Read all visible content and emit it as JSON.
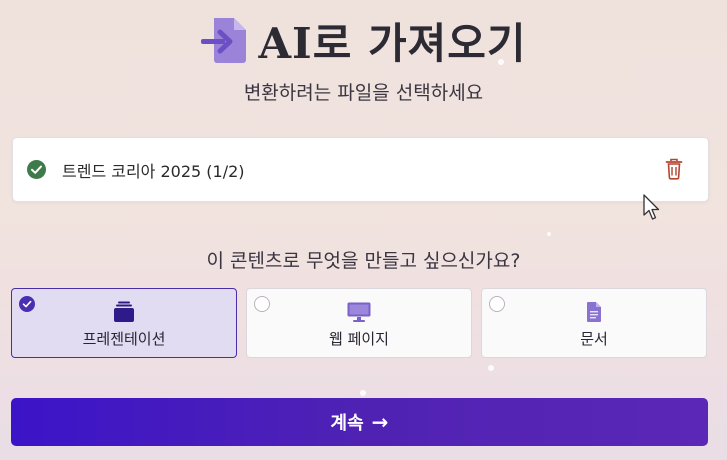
{
  "header": {
    "title": "AI로 가져오기",
    "subtitle": "변환하려는 파일을 선택하세요",
    "icon": "import-file-icon"
  },
  "file": {
    "name": "트렌드 코리아 2025 (1/2)",
    "status_icon": "check-circle-icon",
    "delete_icon": "trash-icon"
  },
  "question": "이 콘텐츠로 무엇을 만들고 싶으신가요?",
  "options": [
    {
      "label": "프레젠테이션",
      "icon": "presentation-stack-icon",
      "selected": true
    },
    {
      "label": "웹 페이지",
      "icon": "monitor-icon",
      "selected": false
    },
    {
      "label": "문서",
      "icon": "document-icon",
      "selected": false
    }
  ],
  "continue_button": {
    "label": "계속",
    "arrow": "→"
  },
  "colors": {
    "accent": "#4b2fb3",
    "button_start": "#3c14c8",
    "button_end": "#5b27b6",
    "success": "#3f7a4a",
    "danger": "#b4452e"
  }
}
